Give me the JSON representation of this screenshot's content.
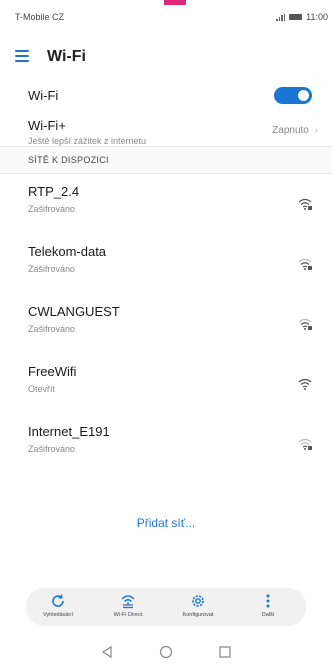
{
  "status_bar": {
    "carrier": "T-Mobile CZ",
    "time": "11:00"
  },
  "app_bar": {
    "title": "Wi-Fi"
  },
  "wifi_toggle": {
    "label": "Wi-Fi",
    "state": "on"
  },
  "wifi_plus": {
    "label": "Wi-Fi+",
    "subtitle": "Ještě lepší zážitek z internetu",
    "status": "Zapnuto"
  },
  "available_section": {
    "header": "SÍTĚ K DISPOZICI"
  },
  "networks": [
    {
      "name": "RTP_2.4",
      "status": "Zašifrováno",
      "secured": true
    },
    {
      "name": "Telekom-data",
      "status": "Zašifrováno",
      "secured": true
    },
    {
      "name": "CWLANGUEST",
      "status": "Zašifrováno",
      "secured": true
    },
    {
      "name": "FreeWifi",
      "status": "Otevřít",
      "secured": false
    },
    {
      "name": "Internet_E191",
      "status": "Zašifrováno",
      "secured": true
    }
  ],
  "add_network": "Přidat síť...",
  "bottom_actions": [
    {
      "label": "Vyhledávání",
      "icon": "refresh-icon"
    },
    {
      "label": "Wi-Fi Direct",
      "icon": "wifi-direct-icon"
    },
    {
      "label": "Konfigurovat",
      "icon": "gear-icon"
    },
    {
      "label": "Další",
      "icon": "more-vertical-icon"
    }
  ],
  "colors": {
    "accent": "#1976d2"
  }
}
